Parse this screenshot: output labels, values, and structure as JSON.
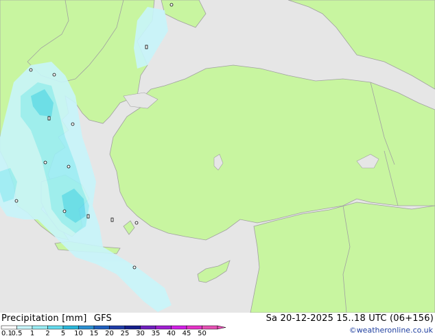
{
  "header": {
    "parameter": "Precipitation [mm]",
    "model": "GFS",
    "valid_time": "Sa 20-12-2025 15..18 UTC (06+156)"
  },
  "credit": "©weatheronline.co.uk",
  "legend": {
    "ticks": [
      "0.1",
      "0.5",
      "1",
      "2",
      "5",
      "10",
      "15",
      "20",
      "25",
      "30",
      "35",
      "40",
      "45",
      "50"
    ],
    "colors": [
      "#ffffff",
      "#c8f5fa",
      "#9beef5",
      "#64dcee",
      "#2ab8dc",
      "#2a90d2",
      "#1f5fbf",
      "#1e3ca8",
      "#141e8c",
      "#6e1ebe",
      "#a01ed2",
      "#d21ee6",
      "#e632c8",
      "#e650b4"
    ]
  },
  "map": {
    "land_color": "#c8f5a0",
    "sea_color": "#e6e6e6",
    "border_color": "#a0a0a0"
  }
}
